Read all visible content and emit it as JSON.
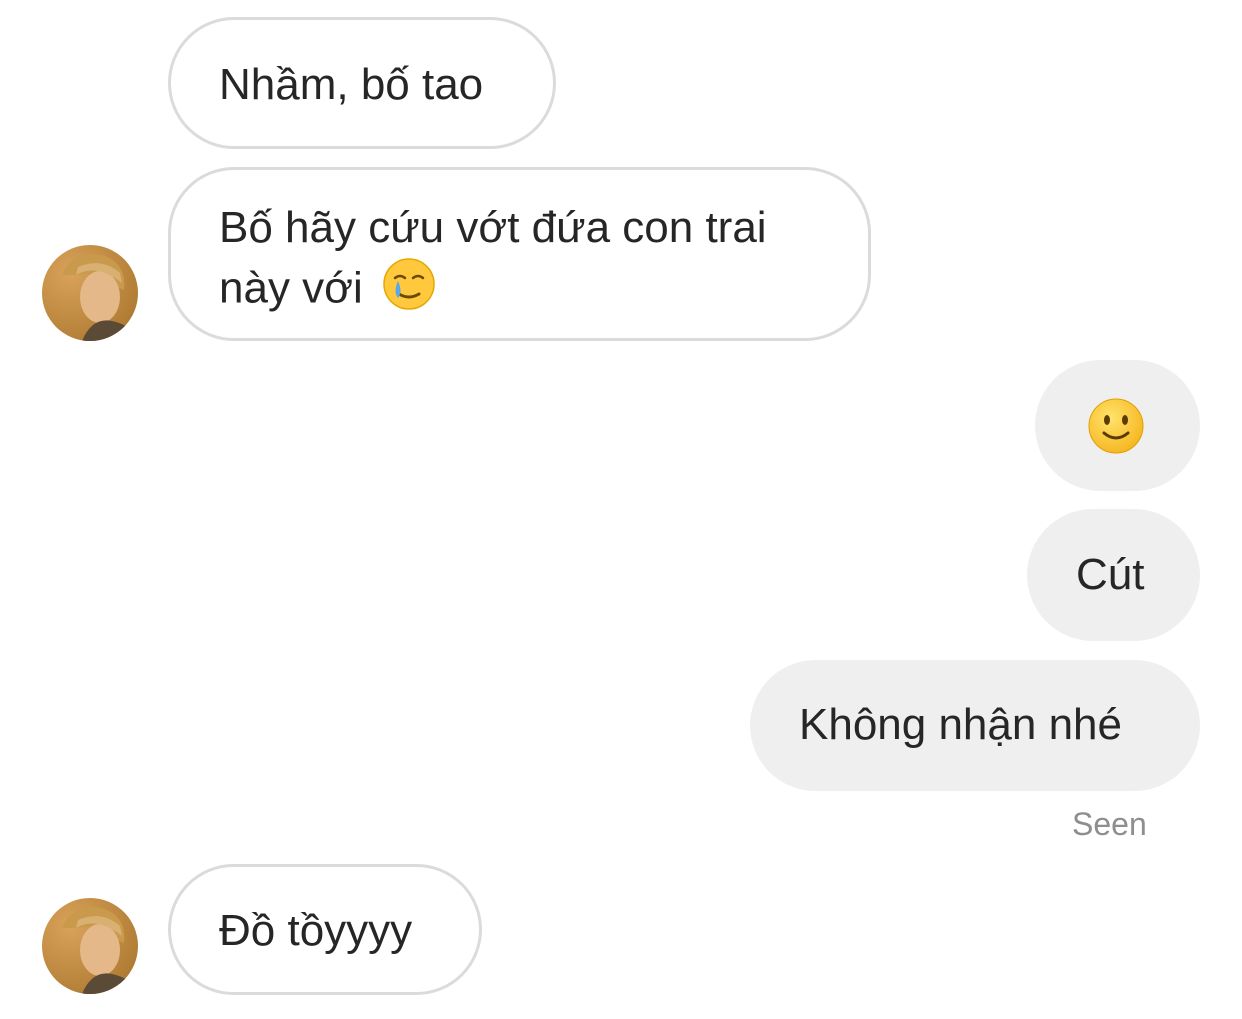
{
  "conversation": {
    "messages": [
      {
        "sender": "them",
        "text": "Nhầm, bố tao"
      },
      {
        "sender": "them",
        "line1": "Bố hãy cứu vớt đứa con trai",
        "line2": "này với",
        "emoji": "face-holding-back-tears-icon"
      },
      {
        "sender": "me",
        "emoji": "slightly-smiling-face-icon"
      },
      {
        "sender": "me",
        "text": "Cút"
      },
      {
        "sender": "me",
        "text": "Không nhận nhé"
      },
      {
        "sender": "them",
        "text": "Đồ tồyyyy"
      }
    ],
    "status": "Seen"
  },
  "colors": {
    "incoming_bubble_border": "#dbdbdb",
    "outgoing_bubble_bg": "#efefef",
    "text": "#262626",
    "seen_text": "#8e8e8e",
    "emoji_yellow": "#ffc83d",
    "tear_blue": "#5aa9e6"
  }
}
